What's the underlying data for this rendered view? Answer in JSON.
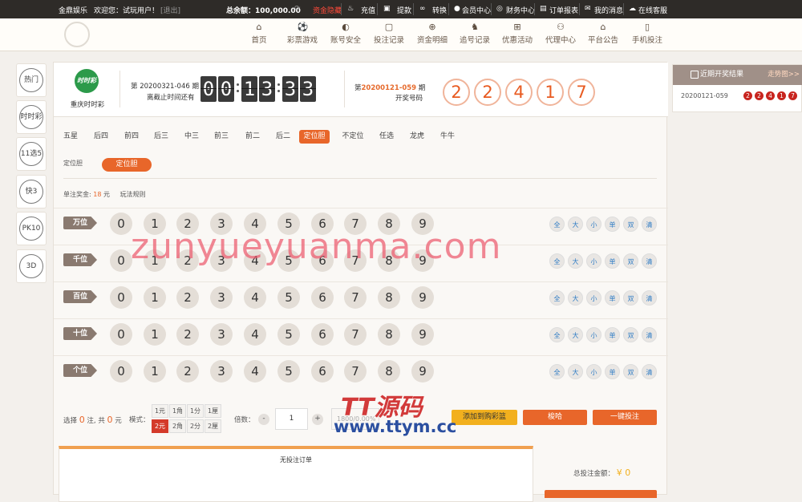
{
  "topbar": {
    "brand": "金鼎娱乐",
    "welcome": "欢迎您：试玩用户！",
    "logout": "[退出]",
    "balance": "总余额：100,000.00",
    "refresh_icon": "refresh-icon",
    "hide": "资金隐藏",
    "items": [
      {
        "icon": "recharge-icon",
        "label": "充值"
      },
      {
        "icon": "withdraw-icon",
        "label": "提款"
      },
      {
        "icon": "transfer-icon",
        "label": "转换"
      },
      {
        "icon": "user-icon",
        "label": "会员中心"
      },
      {
        "icon": "finance-icon",
        "label": "财务中心"
      },
      {
        "icon": "order-icon",
        "label": "订单报表"
      },
      {
        "icon": "mail-icon",
        "label": "我的消息"
      },
      {
        "icon": "service-icon",
        "label": "在线客服"
      }
    ]
  },
  "nav": [
    {
      "icon": "home-icon",
      "label": "首页"
    },
    {
      "icon": "ball-icon",
      "label": "彩票游戏"
    },
    {
      "icon": "shield-icon",
      "label": "账号安全"
    },
    {
      "icon": "record-icon",
      "label": "投注记录"
    },
    {
      "icon": "money-icon",
      "label": "资金明细"
    },
    {
      "icon": "chase-icon",
      "label": "追号记录"
    },
    {
      "icon": "gift-icon",
      "label": "优惠活动"
    },
    {
      "icon": "agent-icon",
      "label": "代理中心"
    },
    {
      "icon": "notice-icon",
      "label": "平台公告"
    },
    {
      "icon": "mobile-icon",
      "label": "手机投注"
    }
  ],
  "sidebar": [
    "热门",
    "时时彩",
    "11选5",
    "快3",
    "PK10",
    "3D"
  ],
  "lottery": {
    "logo_text": "时时彩",
    "name": "重庆时时彩",
    "current_issue": "第 20200321-046 期",
    "deadline": "离截止时间还有",
    "countdown": [
      "00",
      "13",
      "33"
    ],
    "last_prefix": "第",
    "last_issue": "20200121-059",
    "last_suffix": " 期",
    "last_label": "开奖号码",
    "last_balls": [
      "2",
      "2",
      "4",
      "1",
      "7"
    ]
  },
  "tabs": [
    "五星",
    "后四",
    "前四",
    "后三",
    "中三",
    "前三",
    "前二",
    "后二",
    "定位胆",
    "不定位",
    "任选",
    "龙虎",
    "牛牛"
  ],
  "active_tab": "定位胆",
  "subplay": {
    "label": "定位胆",
    "button": "定位胆"
  },
  "prize": {
    "label": "单注奖金:",
    "value": "18",
    "unit": "元",
    "rules": "玩法规则"
  },
  "positions": [
    "万位",
    "千位",
    "百位",
    "十位",
    "个位"
  ],
  "digits": [
    "0",
    "1",
    "2",
    "3",
    "4",
    "5",
    "6",
    "7",
    "8",
    "9"
  ],
  "filters": [
    "全",
    "大",
    "小",
    "单",
    "双",
    "清"
  ],
  "bottom": {
    "selected_prefix": "选择",
    "selected_count": "0",
    "selected_mid": "注, 共",
    "selected_amount": "0",
    "selected_suffix": "元",
    "mode_label": "模式：",
    "units": [
      "1元",
      "1角",
      "1分",
      "1厘",
      "2元",
      "2角",
      "2分",
      "2厘"
    ],
    "active_unit": "2元",
    "multiple_label": "倍数：",
    "minus": "-",
    "multiple": "1",
    "plus": "+",
    "rate": "1800/0.00%",
    "add_cart": "添加到购彩篮",
    "quick": "梭哈",
    "one_click": "一键投注"
  },
  "orders": {
    "empty": "无投注订单"
  },
  "total": {
    "label": "总投注金额：",
    "value": "¥ 0"
  },
  "recent": {
    "title": "近期开奖结果",
    "more": "走势图>>",
    "issue": "20200121-059",
    "balls": [
      "2",
      "2",
      "4",
      "1",
      "7"
    ]
  },
  "watermarks": [
    "zunyueyuanma.com",
    "TT源码",
    "www.ttym.cc"
  ],
  "colors": {
    "accent": "#e8662a",
    "dark": "#2e2b28",
    "ball_red": "#c8241e"
  }
}
